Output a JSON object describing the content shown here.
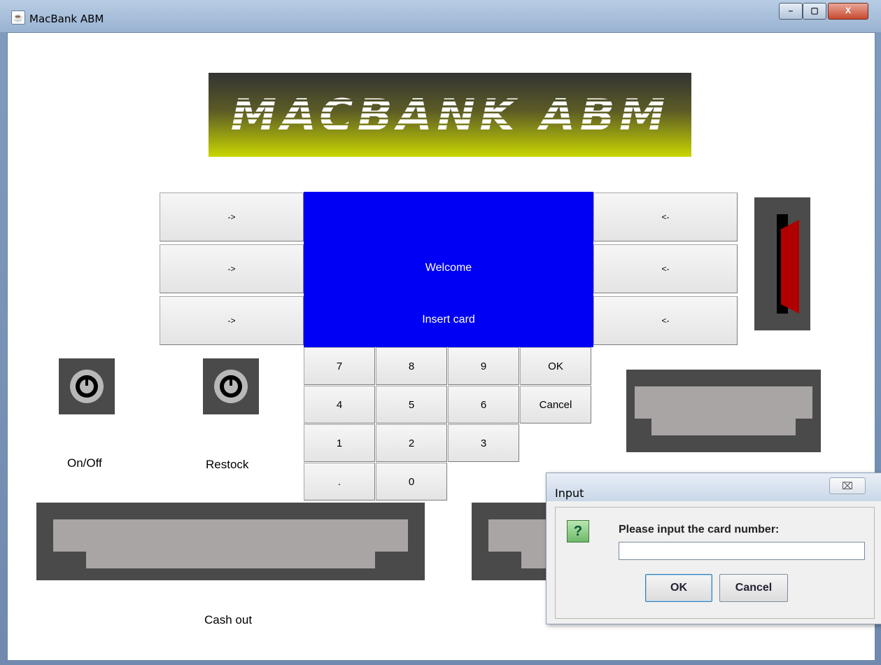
{
  "window": {
    "title": "MacBank ABM",
    "min": "–",
    "max": "▢",
    "close": "X"
  },
  "logo": {
    "text": "MACBANK ABM"
  },
  "screen": {
    "line1": "Welcome",
    "line2": "Insert card"
  },
  "side_buttons": {
    "left": [
      "->",
      "->",
      "->"
    ],
    "right": [
      "<-",
      "<-",
      "<-"
    ]
  },
  "keypad": {
    "row1": [
      "7",
      "8",
      "9",
      "OK"
    ],
    "row2": [
      "4",
      "5",
      "6",
      "Cancel"
    ],
    "row3": [
      "1",
      "2",
      "3"
    ],
    "row4": [
      ".",
      "0"
    ]
  },
  "labels": {
    "onoff": "On/Off",
    "restock": "Restock",
    "cashout": "Cash out"
  },
  "dialog": {
    "title": "Input",
    "close": "⌧",
    "icon": "?",
    "prompt": "Please input the card number:",
    "input_value": "",
    "ok": "OK",
    "cancel": "Cancel"
  },
  "colors": {
    "screen": "#0000f5",
    "card": "#b00000",
    "slot": "#4a4a4a"
  }
}
